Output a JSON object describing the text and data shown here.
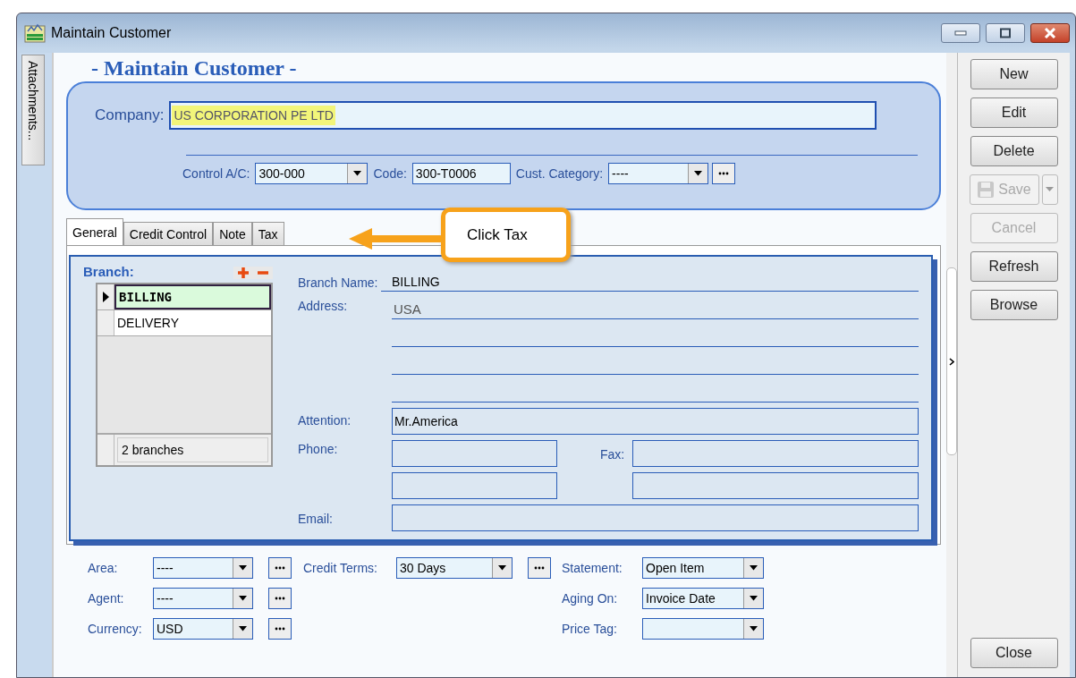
{
  "window": {
    "title": "Maintain Customer"
  },
  "attachments_tab": {
    "label": "Attachments..."
  },
  "heading": "- Maintain Customer -",
  "company": {
    "label": "Company:",
    "value": "US CORPORATION PE LTD",
    "highlighted": true
  },
  "header_fields": [
    {
      "label": "Control A/C:",
      "value": "300-000",
      "kind": "combo"
    },
    {
      "label": "Code:",
      "value": "300-T0006",
      "kind": "text"
    },
    {
      "label": "Cust. Category:",
      "value": "----",
      "kind": "combo-lookup"
    }
  ],
  "tabs": [
    {
      "label": "General",
      "selected": true
    },
    {
      "label": "Credit Control",
      "selected": false
    },
    {
      "label": "Note",
      "selected": false
    },
    {
      "label": "Tax",
      "selected": false
    }
  ],
  "callout": {
    "text": "Click Tax"
  },
  "branch": {
    "label": "Branch:",
    "rows": [
      {
        "name": "BILLING",
        "selected": true
      },
      {
        "name": "DELIVERY",
        "selected": false
      }
    ],
    "footer": "2 branches"
  },
  "details": {
    "branch_name": {
      "label": "Branch Name:",
      "value": "BILLING"
    },
    "address": {
      "label": "Address:",
      "lines": [
        "USA"
      ]
    },
    "attention": {
      "label": "Attention:",
      "value": "Mr.America"
    },
    "phone": {
      "label": "Phone:"
    },
    "fax": {
      "label": "Fax:"
    },
    "email": {
      "label": "Email:"
    }
  },
  "bottom_columns": [
    [
      {
        "label": "Area:",
        "value": "----",
        "lookup": true
      },
      {
        "label": "Agent:",
        "value": "----",
        "lookup": true
      },
      {
        "label": "Currency:",
        "value": "USD",
        "lookup": true
      }
    ],
    [
      {
        "label": "Credit Terms:",
        "value": "30 Days",
        "lookup": true
      }
    ],
    [
      {
        "label": "Statement:",
        "value": "Open Item",
        "lookup": false
      },
      {
        "label": "Aging On:",
        "value": "Invoice Date",
        "lookup": false
      },
      {
        "label": "Price Tag:",
        "lookup": false
      }
    ]
  ],
  "buttons": [
    {
      "label": "New",
      "disabled": false,
      "kind": "plain"
    },
    {
      "label": "Edit",
      "disabled": false,
      "kind": "plain"
    },
    {
      "label": "Delete",
      "disabled": false,
      "kind": "plain"
    },
    {
      "label": "Save",
      "disabled": true,
      "kind": "split"
    },
    {
      "label": "Cancel",
      "disabled": true,
      "kind": "plain"
    },
    {
      "label": "Refresh",
      "disabled": false,
      "kind": "plain"
    },
    {
      "label": "Browse",
      "disabled": false,
      "kind": "plain"
    }
  ],
  "close_button": {
    "label": "Close"
  }
}
